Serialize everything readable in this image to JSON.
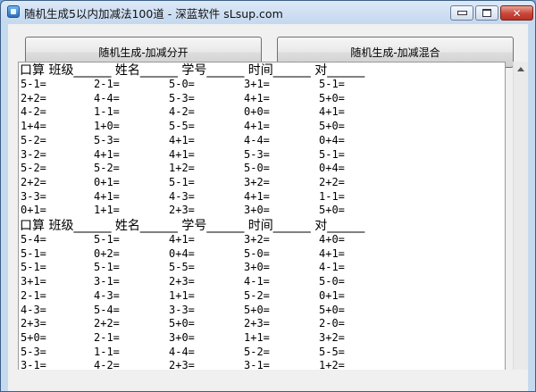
{
  "window": {
    "title": "随机生成5以内加减法100道 - 深蓝软件 sLsup.com",
    "icon": "app-icon"
  },
  "toolbar": {
    "separate_label": "随机生成-加减分开",
    "mixed_label": "随机生成-加减混合"
  },
  "worksheet": {
    "header": "口算  班级______ 姓名______ 学号______ 时间______ 对______",
    "blocks": [
      {
        "rows": [
          [
            "5-1=",
            "2-1=",
            "5-0=",
            "3+1=",
            "5-1="
          ],
          [
            "2+2=",
            "4-4=",
            "5-3=",
            "4+1=",
            "5+0="
          ],
          [
            "4-2=",
            "1-1=",
            "4-2=",
            "0+0=",
            "4+1="
          ],
          [
            "1+4=",
            "1+0=",
            "5-5=",
            "4+1=",
            "5+0="
          ],
          [
            "5-2=",
            "5-3=",
            "4+1=",
            "4-4=",
            "0+4="
          ],
          [
            "3-2=",
            "4+1=",
            "4+1=",
            "5-3=",
            "5-1="
          ],
          [
            "5-2=",
            "5-2=",
            "1+2=",
            "5-0=",
            "0+4="
          ],
          [
            "2+2=",
            "0+1=",
            "5-1=",
            "3+2=",
            "2+2="
          ],
          [
            "3-3=",
            "4+1=",
            "4-3=",
            "4+1=",
            "1-1="
          ],
          [
            "0+1=",
            "1+1=",
            "2+3=",
            "3+0=",
            "5+0="
          ]
        ]
      },
      {
        "rows": [
          [
            "5-4=",
            "5-1=",
            "4+1=",
            "3+2=",
            "4+0="
          ],
          [
            "5-1=",
            "0+2=",
            "0+4=",
            "5-0=",
            "4+1="
          ],
          [
            "5-1=",
            "5-1=",
            "5-5=",
            "3+0=",
            "4-1="
          ],
          [
            "3+1=",
            "3-1=",
            "2+3=",
            "4-1=",
            "5-0="
          ],
          [
            "2-1=",
            "4-3=",
            "1+1=",
            "5-2=",
            "0+1="
          ],
          [
            "4-3=",
            "5-4=",
            "3-3=",
            "5+0=",
            "5+0="
          ],
          [
            "2+3=",
            "2+2=",
            "5+0=",
            "2+3=",
            "2-0="
          ],
          [
            "5+0=",
            "2-1=",
            "3+0=",
            "1+1=",
            "3+2="
          ],
          [
            "5-3=",
            "1-1=",
            "4-4=",
            "5-2=",
            "5-5="
          ],
          [
            "3-1=",
            "4-2=",
            "2+3=",
            "3-1=",
            "1+2="
          ]
        ]
      }
    ]
  }
}
